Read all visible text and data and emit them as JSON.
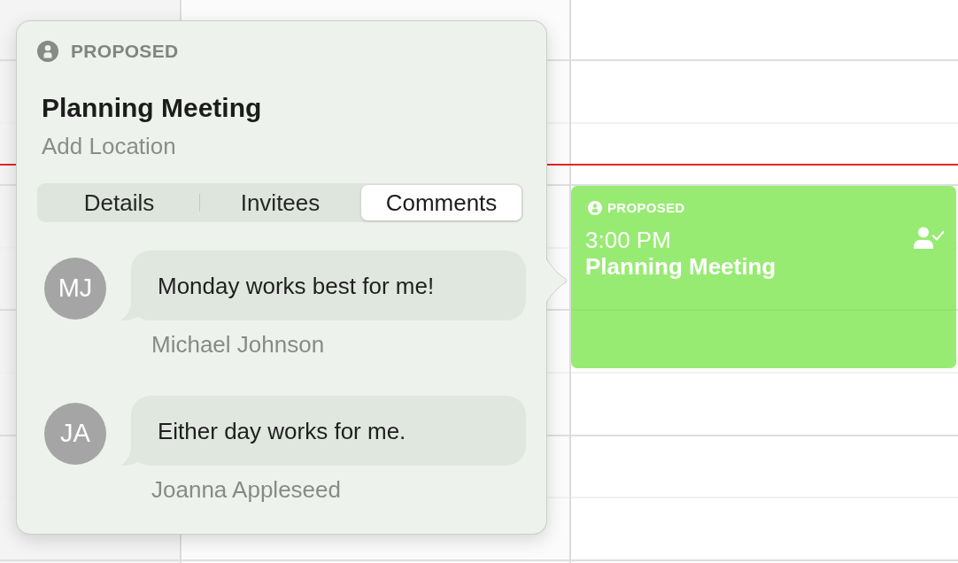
{
  "popover": {
    "status": "PROPOSED",
    "title": "Planning Meeting",
    "location": {
      "placeholder": "Add Location"
    },
    "tabs": [
      {
        "label": "Details",
        "selected": false
      },
      {
        "label": "Invitees",
        "selected": false
      },
      {
        "label": "Comments",
        "selected": true
      }
    ],
    "comments": [
      {
        "initials": "MJ",
        "text": "Monday works best for me!",
        "author": "Michael Johnson"
      },
      {
        "initials": "JA",
        "text": "Either day works for me.",
        "author": "Joanna Appleseed"
      }
    ]
  },
  "calendar_event": {
    "status": "PROPOSED",
    "time": "3:00 PM",
    "title": "Planning Meeting"
  }
}
